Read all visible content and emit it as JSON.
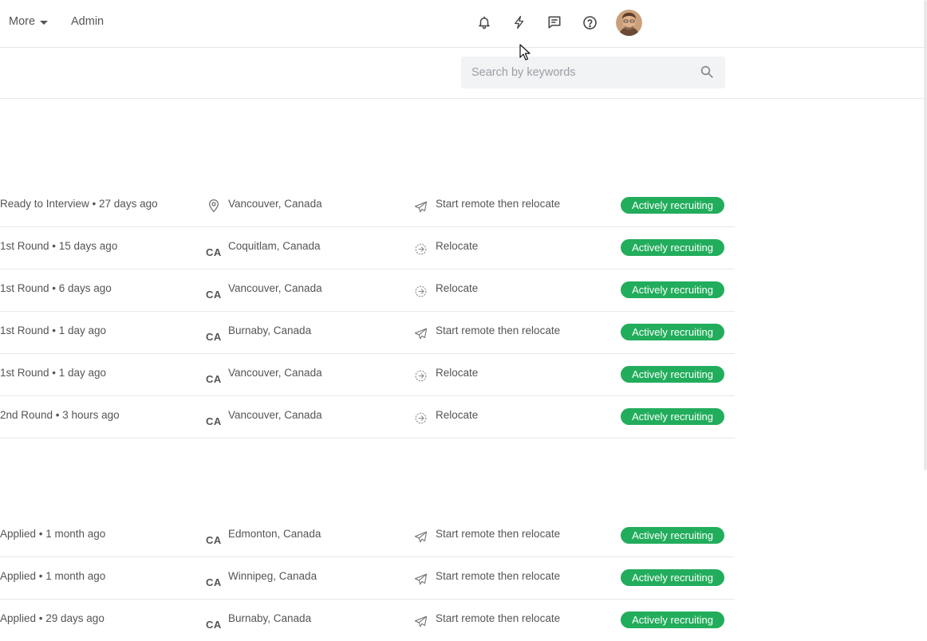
{
  "nav": {
    "more_label": "More",
    "admin_label": "Admin"
  },
  "icons": {
    "notifications": "bell-icon",
    "quick_actions": "lightning-icon",
    "messages": "chat-icon",
    "help": "help-icon"
  },
  "search": {
    "placeholder": "Search by keywords",
    "value": ""
  },
  "colors": {
    "badge": "#22ad5c"
  },
  "group1": [
    {
      "stage": "Ready to Interview • 27 days ago",
      "location_icon": "pin",
      "location": "Vancouver, Canada",
      "relocation_icon": "paper-plane",
      "relocation": "Start remote then relocate",
      "status": "Actively recruiting"
    },
    {
      "stage": "1st Round • 15 days ago",
      "location_icon": "CA",
      "location": "Coquitlam, Canada",
      "relocation_icon": "relocate",
      "relocation": "Relocate",
      "status": "Actively recruiting"
    },
    {
      "stage": "1st Round • 6 days ago",
      "location_icon": "CA",
      "location": "Vancouver, Canada",
      "relocation_icon": "relocate",
      "relocation": "Relocate",
      "status": "Actively recruiting"
    },
    {
      "stage": "1st Round • 1 day ago",
      "location_icon": "CA",
      "location": "Burnaby, Canada",
      "relocation_icon": "paper-plane",
      "relocation": "Start remote then relocate",
      "status": "Actively recruiting"
    },
    {
      "stage": "1st Round • 1 day ago",
      "location_icon": "CA",
      "location": "Vancouver, Canada",
      "relocation_icon": "relocate",
      "relocation": "Relocate",
      "status": "Actively recruiting"
    },
    {
      "stage": "2nd Round • 3 hours ago",
      "location_icon": "CA",
      "location": "Vancouver, Canada",
      "relocation_icon": "relocate",
      "relocation": "Relocate",
      "status": "Actively recruiting"
    }
  ],
  "group2": [
    {
      "stage": "Applied • 1 month ago",
      "location_icon": "CA",
      "location": "Edmonton, Canada",
      "relocation_icon": "paper-plane",
      "relocation": "Start remote then relocate",
      "status": "Actively recruiting"
    },
    {
      "stage": "Applied • 1 month ago",
      "location_icon": "CA",
      "location": "Winnipeg, Canada",
      "relocation_icon": "paper-plane",
      "relocation": "Start remote then relocate",
      "status": "Actively recruiting"
    },
    {
      "stage": "Applied • 29 days ago",
      "location_icon": "CA",
      "location": "Burnaby, Canada",
      "relocation_icon": "paper-plane",
      "relocation": "Start remote then relocate",
      "status": "Actively recruiting"
    }
  ]
}
